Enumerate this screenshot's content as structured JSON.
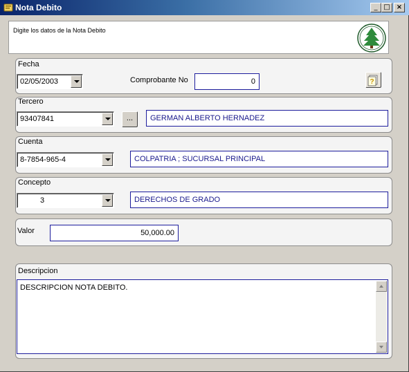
{
  "window": {
    "title": "Nota Debito",
    "minimize": "_",
    "maximize": "□",
    "close": "×"
  },
  "header": {
    "hint": "Digite los datos de la Nota Debito",
    "logo_icon": "institution-seal-logo"
  },
  "fecha": {
    "label": "Fecha",
    "value": "02/05/2003"
  },
  "comprobante": {
    "label": "Comprobante No",
    "value": "0"
  },
  "tercero": {
    "label": "Tercero",
    "code": "93407841",
    "browse_label": "...",
    "name": "GERMAN ALBERTO HERNADEZ"
  },
  "cuenta": {
    "label": "Cuenta",
    "code": "8-7854-965-4",
    "name": "COLPATRIA ;  SUCURSAL PRINCIPAL"
  },
  "concepto": {
    "label": "Concepto",
    "code": "3",
    "name": "DERECHOS DE GRADO"
  },
  "valor": {
    "label": "Valor",
    "value": "50,000.00"
  },
  "descripcion": {
    "label": "Descripcion",
    "value": "DESCRIPCION NOTA DEBITO."
  },
  "icons": {
    "help": "help-icon",
    "title": "window-app-icon"
  },
  "colors": {
    "field_border": "#1c1c9c",
    "text_blue": "#1a1a8c",
    "title_gradient_start": "#0a246a"
  }
}
